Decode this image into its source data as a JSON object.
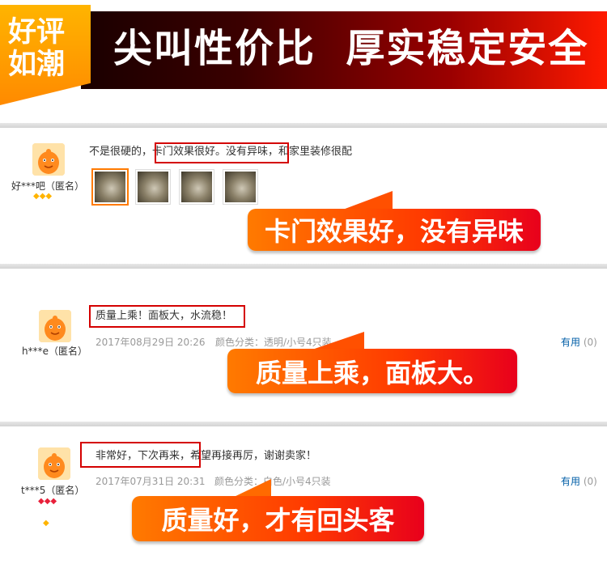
{
  "banner": {
    "badge_line1": "好评",
    "badge_line2": "如潮",
    "slogan": "尖叫性价比  厚实稳定安全"
  },
  "reviews": [
    {
      "user": "好***吧（匿名）",
      "text_before": "不是很硬的，",
      "text_highlight": "卡门效果很好。没有异味，",
      "text_after": "和家里装修很配",
      "callout": "卡门效果好，没有异味"
    },
    {
      "user": "h***e（匿名）",
      "text_highlight": "质量上乘！面板大，水流稳！",
      "date": "2017年08月29日 20:26",
      "spec": "颜色分类：透明/小号4只装",
      "useful_label": "有用",
      "useful_count": "(0)",
      "callout": "质量上乘，面板大。"
    },
    {
      "user": "t***5（匿名）",
      "text_highlight": "非常好，下次再来，",
      "text_after": "希望再接再厉，谢谢卖家！",
      "date": "2017年07月31日 20:31",
      "spec": "颜色分类：白色/小号4只装",
      "useful_label": "有用",
      "useful_count": "(0)",
      "callout": "质量好，才有回头客"
    }
  ],
  "colors": {
    "highlight_border": "#d40000",
    "callout_start": "#ff7a00",
    "callout_end": "#e8001c",
    "link": "#005ea7"
  },
  "icons": [
    "avatar-icon",
    "diamond-icon"
  ]
}
